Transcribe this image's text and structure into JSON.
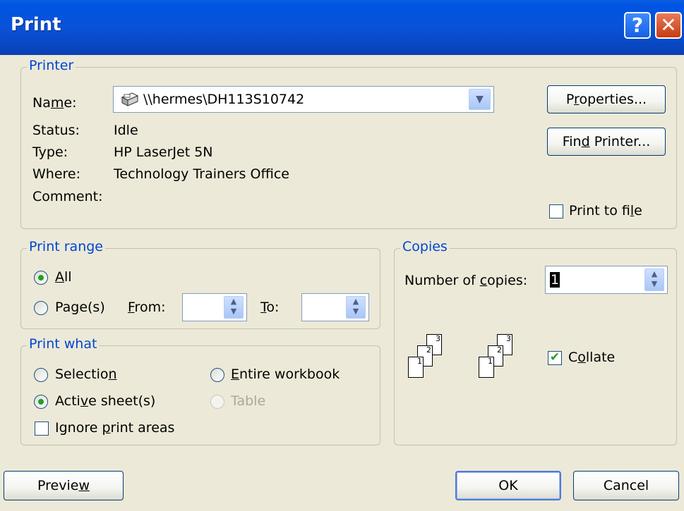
{
  "window": {
    "title": "Print",
    "help_symbol": "?",
    "close_symbol": "✕"
  },
  "printer": {
    "legend": "Printer",
    "name_label": "Name:",
    "name_value": "\\\\hermes\\DH113S10742",
    "status_label": "Status:",
    "status_value": "Idle",
    "type_label": "Type:",
    "type_value": "HP LaserJet 5N",
    "where_label": "Where:",
    "where_value": "Technology Trainers Office",
    "comment_label": "Comment:",
    "comment_value": "",
    "properties_label": "Properties...",
    "find_printer_label": "Find Printer...",
    "print_to_file_label": "Print to file",
    "print_to_file_checked": false
  },
  "print_range": {
    "legend": "Print range",
    "all_label": "All",
    "pages_label": "Page(s)",
    "from_label": "From:",
    "to_label": "To:",
    "from_value": "",
    "to_value": "",
    "selected": "All"
  },
  "print_what": {
    "legend": "Print what",
    "selection_label": "Selection",
    "entire_workbook_label": "Entire workbook",
    "active_sheets_label": "Active sheet(s)",
    "table_label": "Table",
    "ignore_label": "Ignore print areas",
    "selected": "Active sheet(s)",
    "ignore_checked": false
  },
  "copies": {
    "legend": "Copies",
    "number_label": "Number of copies:",
    "number_value": "1",
    "collate_label": "Collate",
    "collate_checked": true,
    "stack_pages": [
      "1",
      "2",
      "3"
    ]
  },
  "footer": {
    "preview_label": "Preview",
    "ok_label": "OK",
    "cancel_label": "Cancel"
  },
  "colors": {
    "title_bar": "#0054e3",
    "legend": "#0046d5",
    "dialog_bg": "#ece9d8",
    "check_mark": "#21a121"
  },
  "icons": {
    "printer": "printer-icon",
    "dropdown": "chevron-down-icon",
    "spinner": "spin-updown-icon"
  }
}
